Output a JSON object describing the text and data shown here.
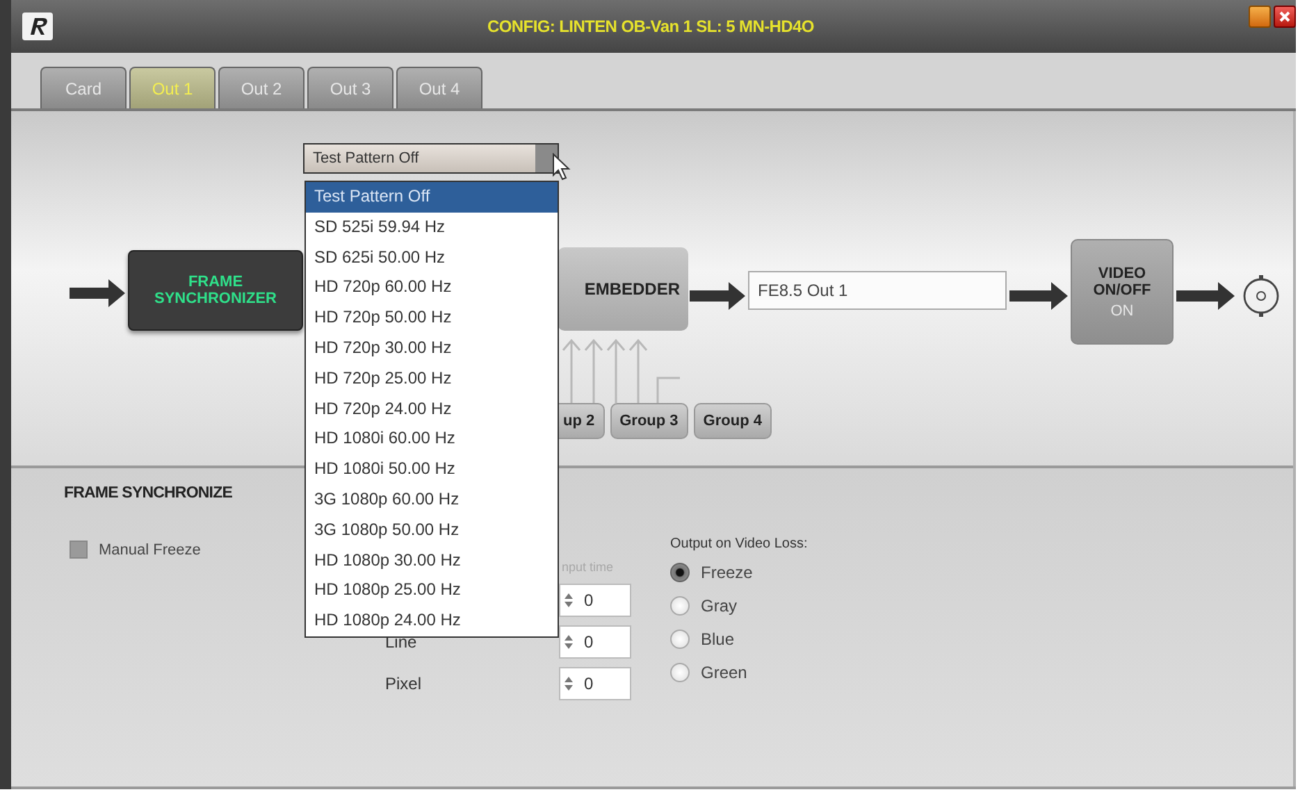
{
  "window": {
    "title": "CONFIG: LINTEN OB-Van 1   SL: 5  MN-HD4O"
  },
  "tabs": [
    {
      "label": "Card",
      "selected": false
    },
    {
      "label": "Out 1",
      "selected": true
    },
    {
      "label": "Out 2",
      "selected": false
    },
    {
      "label": "Out 3",
      "selected": false
    },
    {
      "label": "Out 4",
      "selected": false
    }
  ],
  "diagram": {
    "frame_sync": [
      "FRAME",
      "SYNCHRONIZER"
    ],
    "embedder": "EMBEDDER",
    "source_name": "FE8.5 Out 1",
    "video_switch": {
      "lines": [
        "VIDEO",
        "ON/OFF"
      ],
      "state": "ON"
    },
    "groups": [
      "up 2",
      "Group 3",
      "Group 4"
    ]
  },
  "test_pattern": {
    "value": "Test Pattern Off",
    "expanded": true,
    "options": [
      {
        "label": "Test Pattern Off",
        "selected": true
      },
      {
        "label": "SD 525i 59.94 Hz",
        "selected": false
      },
      {
        "label": "SD 625i 50.00 Hz",
        "selected": false
      },
      {
        "label": "HD 720p 60.00 Hz",
        "selected": false
      },
      {
        "label": "HD 720p 50.00 Hz",
        "selected": false
      },
      {
        "label": "HD 720p 30.00 Hz",
        "selected": false
      },
      {
        "label": "HD 720p 25.00 Hz",
        "selected": false
      },
      {
        "label": "HD 720p 24.00 Hz",
        "selected": false
      },
      {
        "label": "HD 1080i 60.00 Hz",
        "selected": false
      },
      {
        "label": "HD 1080i 50.00 Hz",
        "selected": false
      },
      {
        "label": "3G 1080p 60.00 Hz",
        "selected": false
      },
      {
        "label": "3G 1080p 50.00 Hz",
        "selected": false
      },
      {
        "label": "HD 1080p 30.00 Hz",
        "selected": false
      },
      {
        "label": "HD 1080p 25.00 Hz",
        "selected": false
      },
      {
        "label": "HD 1080p 24.00 Hz",
        "selected": false
      }
    ]
  },
  "frame_sync_panel": {
    "heading": "FRAME SYNCHRONIZE",
    "manual_freeze": {
      "label": "Manual Freeze",
      "checked": false
    },
    "offset": {
      "caption": "nput time",
      "rows": [
        {
          "value": "0"
        },
        {
          "label": "Line",
          "value": "0"
        },
        {
          "label": "Pixel",
          "value": "0"
        }
      ]
    },
    "video_loss": {
      "label": "Output on Video Loss:",
      "options": [
        {
          "label": "Freeze",
          "selected": true
        },
        {
          "label": "Gray",
          "selected": false
        },
        {
          "label": "Blue",
          "selected": false
        },
        {
          "label": "Green",
          "selected": false
        }
      ]
    }
  }
}
